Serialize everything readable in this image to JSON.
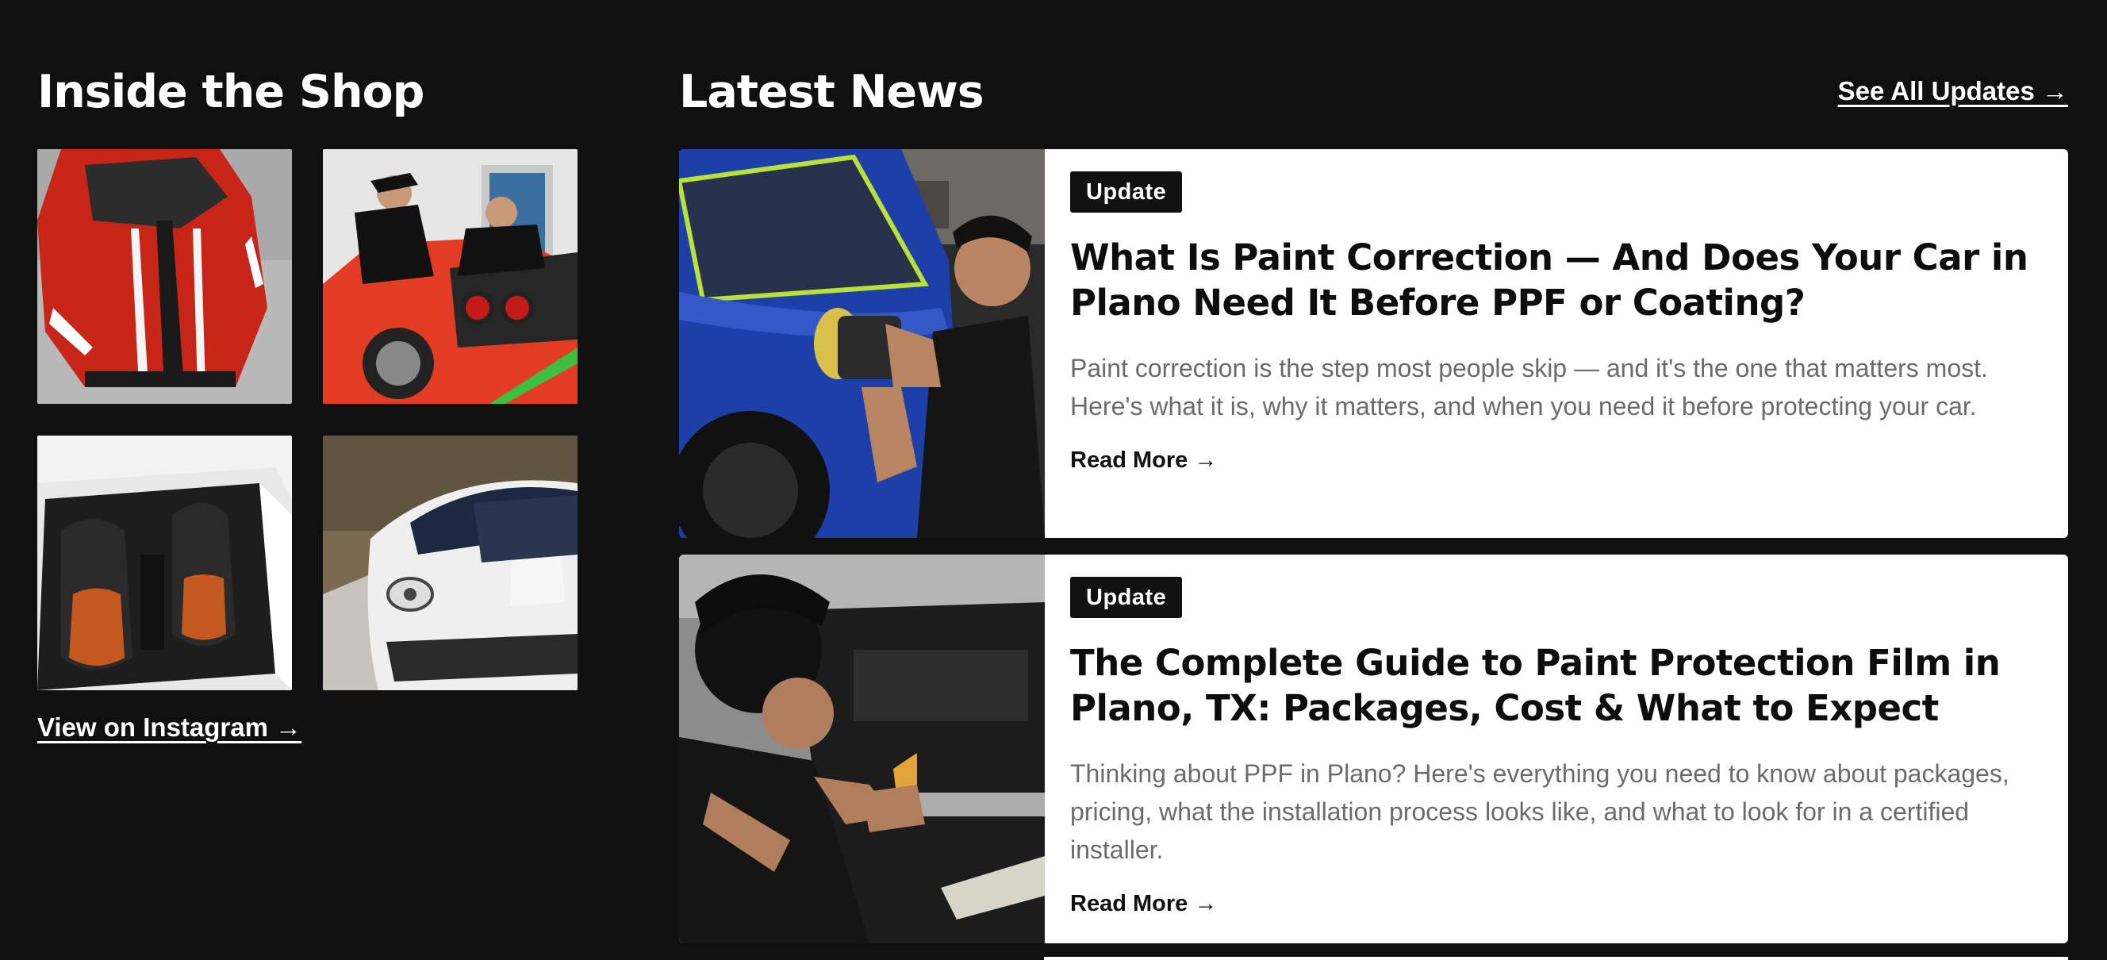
{
  "shop": {
    "title": "Inside the Shop",
    "tiles": [
      {
        "icon": "red-ferrari-hood-stripes-photo"
      },
      {
        "icon": "red-ferrari-spider-installers-photo"
      },
      {
        "icon": "porsche-orange-interior-seats-photo"
      },
      {
        "icon": "white-porsche-gt4-photo"
      }
    ],
    "instagram_link": "View on Instagram →"
  },
  "news": {
    "title": "Latest News",
    "see_all": "See All Updates →",
    "articles": [
      {
        "badge": "Update",
        "title": "What Is Paint Correction — And Does Your Car in Plano Need It Before PPF or Coating?",
        "excerpt": "Paint correction is the step most people skip — and it's the one that matters most. Here's what it is, why it matters, and when you need it before protecting your car.",
        "read_more": "Read More →",
        "image_icon": "technician-polishing-blue-car-photo"
      },
      {
        "badge": "Update",
        "title": "The Complete Guide to Paint Protection Film in Plano, TX: Packages, Cost & What to Expect",
        "excerpt": "Thinking about PPF in Plano? Here's everything you need to know about packages, pricing, what the installation process looks like, and what to look for in a certified installer.",
        "read_more": "Read More →",
        "image_icon": "technician-installing-ppf-photo"
      }
    ]
  }
}
